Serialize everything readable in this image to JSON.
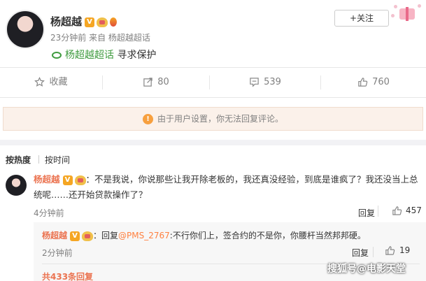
{
  "post": {
    "author": "杨超越",
    "time": "23分钟前",
    "source": "来自 杨超越超话",
    "topic_link": "杨超越超话",
    "topic_text": "寻求保护",
    "follow_label": "+关注"
  },
  "actions": {
    "favorite_label": "收藏",
    "repost_count": "80",
    "comment_count": "539",
    "like_count": "760"
  },
  "notice": "由于用户设置，你无法回复评论。",
  "sort": {
    "hot": "按热度",
    "time": "按时间"
  },
  "comment": {
    "author": "杨超越",
    "text_prefix": "：不是我说，你说那些让我开除老板的，我还真没经验，到底是谁疯了？我还没当上总统呢……还开始贷款操作了？",
    "time": "4分钟前",
    "reply_label": "回复",
    "like_count": "457"
  },
  "reply": {
    "author": "杨超越",
    "prefix": "：回复",
    "mention": "@PMS_2767",
    "text": ":不行你们上，签合约的不是你，你腰杆当然邦邦硬。",
    "time": "2分钟前",
    "reply_label": "回复",
    "like_count": "19"
  },
  "total_replies": "共433条回复",
  "watermark": "搜狐号@电影天堂",
  "colors": {
    "accent": "#eb7350",
    "link": "#ff8140",
    "topic_green": "#3f9b3f",
    "notice_bg": "#fbf1ea"
  }
}
